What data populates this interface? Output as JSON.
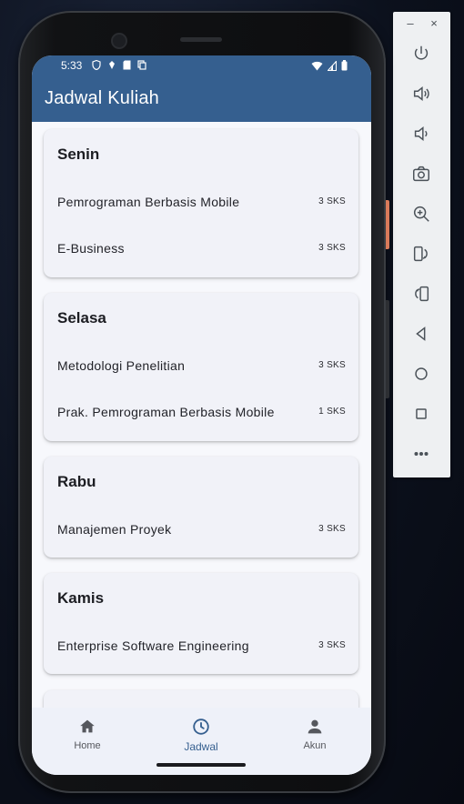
{
  "emulator": {
    "minimize_glyph": "–",
    "close_glyph": "×",
    "buttons": [
      "power-icon",
      "volume-up-icon",
      "volume-down-icon",
      "camera-icon",
      "zoom-icon",
      "rotate-left-icon",
      "rotate-right-icon",
      "back-icon",
      "home-icon",
      "overview-icon",
      "more-icon"
    ]
  },
  "status_bar": {
    "time": "5:33"
  },
  "app_bar": {
    "title": "Jadwal Kuliah",
    "color": "#355f8f"
  },
  "schedule": [
    {
      "day": "Senin",
      "courses": [
        {
          "name": "Pemrograman Berbasis Mobile",
          "sks": "3 SKS"
        },
        {
          "name": "E-Business",
          "sks": "3 SKS"
        }
      ]
    },
    {
      "day": "Selasa",
      "courses": [
        {
          "name": "Metodologi Penelitian",
          "sks": "3 SKS"
        },
        {
          "name": "Prak. Pemrograman Berbasis Mobile",
          "sks": "1 SKS"
        }
      ]
    },
    {
      "day": "Rabu",
      "courses": [
        {
          "name": "Manajemen Proyek",
          "sks": "3 SKS"
        }
      ]
    },
    {
      "day": "Kamis",
      "courses": [
        {
          "name": "Enterprise Software Engineering",
          "sks": "3 SKS"
        }
      ]
    }
  ],
  "bottom_nav": {
    "items": [
      {
        "label": "Home",
        "icon": "home-icon",
        "active": false
      },
      {
        "label": "Jadwal",
        "icon": "clock-icon",
        "active": true
      },
      {
        "label": "Akun",
        "icon": "person-icon",
        "active": false
      }
    ]
  }
}
